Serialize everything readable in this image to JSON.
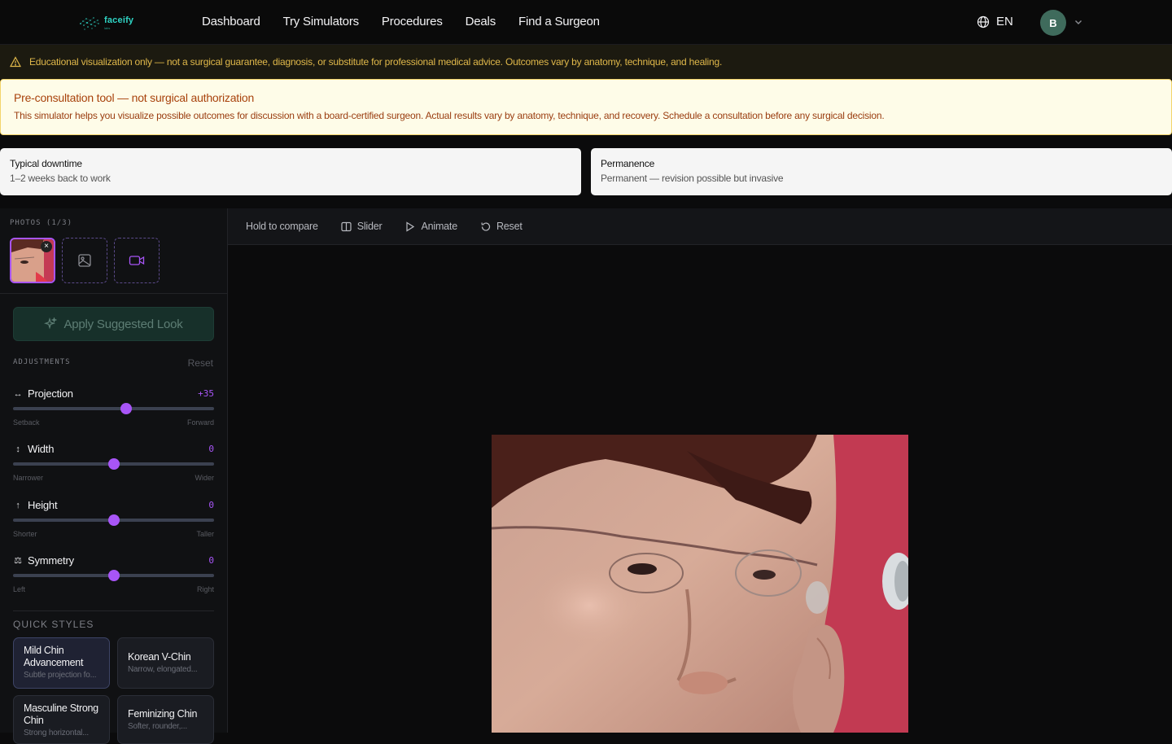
{
  "app": {
    "logo_name": "faceify",
    "logo_sub": "labs"
  },
  "nav": {
    "items": [
      "Dashboard",
      "Try Simulators",
      "Procedures",
      "Deals",
      "Find a Surgeon"
    ]
  },
  "header": {
    "language": "EN",
    "avatar_initial": "B"
  },
  "warning": {
    "text": "Educational visualization only — not a surgical guarantee, diagnosis, or substitute for professional medical advice. Outcomes vary by anatomy, technique, and healing."
  },
  "consult": {
    "title": "Pre-consultation tool — not surgical authorization",
    "body": "This simulator helps you visualize possible outcomes for discussion with a board-certified surgeon. Actual results vary by anatomy, technique, and recovery. Schedule a consultation before any surgical decision."
  },
  "cards": {
    "downtime": {
      "label": "Typical downtime",
      "value": "1–2 weeks back to work"
    },
    "permanence": {
      "label": "Permanence",
      "value": "Permanent — revision possible but invasive"
    }
  },
  "sidebar": {
    "photos_label": "PHOTOS (1/3)",
    "suggest_button": "Apply Suggested Look",
    "adjustments_label": "ADJUSTMENTS",
    "reset_label": "Reset",
    "sliders": [
      {
        "name": "Projection",
        "icon": "↔",
        "value": "+35",
        "level": 0.5625,
        "min_label": "Setback",
        "max_label": "Forward"
      },
      {
        "name": "Width",
        "icon": "↕",
        "value": "0",
        "level": 0.5,
        "min_label": "Narrower",
        "max_label": "Wider"
      },
      {
        "name": "Height",
        "icon": "↑",
        "value": "0",
        "level": 0.5,
        "min_label": "Shorter",
        "max_label": "Taller"
      },
      {
        "name": "Symmetry",
        "icon": "⚖",
        "value": "0",
        "level": 0.5,
        "min_label": "Left",
        "max_label": "Right"
      }
    ],
    "quick_styles_label": "QUICK STYLES",
    "quick_styles": [
      {
        "title": "Mild Chin Advancement",
        "desc": "Subtle projection fo..."
      },
      {
        "title": "Korean V-Chin",
        "desc": "Narrow, elongated..."
      },
      {
        "title": "Masculine Strong Chin",
        "desc": "Strong horizontal..."
      },
      {
        "title": "Feminizing Chin",
        "desc": "Softer, rounder,..."
      }
    ]
  },
  "toolbar": {
    "hold_compare": "Hold to compare",
    "slider": "Slider",
    "animate": "Animate",
    "reset": "Reset"
  },
  "colors": {
    "accent": "#a855f7",
    "warning_text": "#e0b84a",
    "consult_bg": "#fefce8",
    "avatar_bg": "#3f6b5c"
  }
}
